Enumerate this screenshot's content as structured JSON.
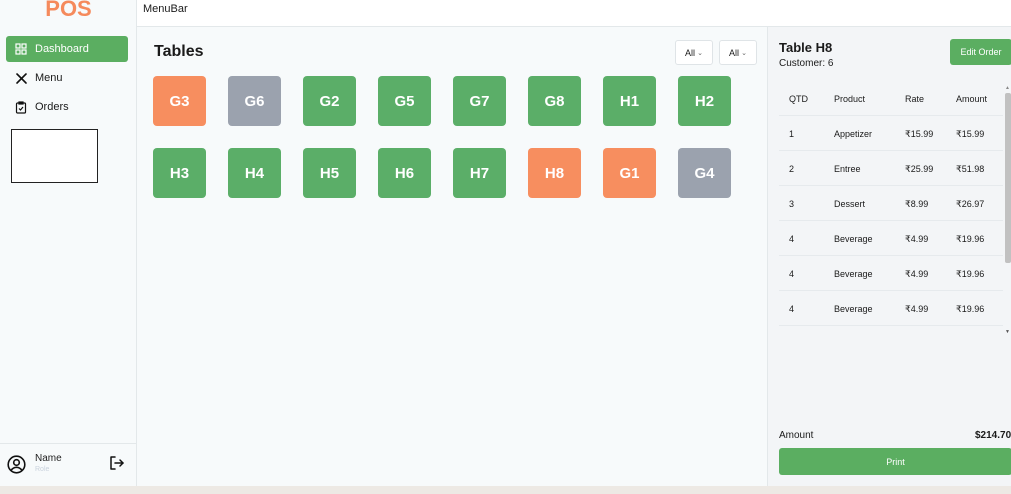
{
  "app": {
    "logo": "POS",
    "menubar": "MenuBar"
  },
  "sidebar": {
    "items": [
      {
        "label": "Dashboard",
        "icon": "dashboard-grid-icon",
        "active": true
      },
      {
        "label": "Menu",
        "icon": "utensils-icon",
        "active": false
      },
      {
        "label": "Orders",
        "icon": "clipboard-icon",
        "active": false
      }
    ],
    "profile": {
      "name": "Name",
      "role": "Role"
    }
  },
  "main": {
    "title": "Tables",
    "filters": [
      {
        "value": "All"
      },
      {
        "value": "All"
      }
    ],
    "tables": [
      {
        "label": "G3",
        "status": "orange"
      },
      {
        "label": "G6",
        "status": "gray"
      },
      {
        "label": "G2",
        "status": "green"
      },
      {
        "label": "G5",
        "status": "green"
      },
      {
        "label": "G7",
        "status": "green"
      },
      {
        "label": "G8",
        "status": "green"
      },
      {
        "label": "H1",
        "status": "green"
      },
      {
        "label": "H2",
        "status": "green"
      },
      {
        "label": "H3",
        "status": "green"
      },
      {
        "label": "H4",
        "status": "green"
      },
      {
        "label": "H5",
        "status": "green"
      },
      {
        "label": "H6",
        "status": "green"
      },
      {
        "label": "H7",
        "status": "green"
      },
      {
        "label": "H8",
        "status": "orange"
      },
      {
        "label": "G1",
        "status": "orange"
      },
      {
        "label": "G4",
        "status": "gray"
      }
    ]
  },
  "order": {
    "title": "Table H8",
    "customer": "Customer: 6",
    "edit_label": "Edit Order",
    "columns": {
      "qtd": "QTD",
      "product": "Product",
      "rate": "Rate",
      "amount": "Amount"
    },
    "rows": [
      {
        "qtd": "1",
        "product": "Appetizer",
        "rate": "₹15.99",
        "amount": "₹15.99"
      },
      {
        "qtd": "2",
        "product": "Entree",
        "rate": "₹25.99",
        "amount": "₹51.98"
      },
      {
        "qtd": "3",
        "product": "Dessert",
        "rate": "₹8.99",
        "amount": "₹26.97"
      },
      {
        "qtd": "4",
        "product": "Beverage",
        "rate": "₹4.99",
        "amount": "₹19.96"
      },
      {
        "qtd": "4",
        "product": "Beverage",
        "rate": "₹4.99",
        "amount": "₹19.96"
      },
      {
        "qtd": "4",
        "product": "Beverage",
        "rate": "₹4.99",
        "amount": "₹19.96"
      }
    ],
    "amount_label": "Amount",
    "amount_value": "$214.70",
    "print_label": "Print"
  },
  "colors": {
    "accent": "#5bae61",
    "occupied": "#f78e5f",
    "reserved": "#9ba2ae",
    "logo": "#f58a5c"
  }
}
